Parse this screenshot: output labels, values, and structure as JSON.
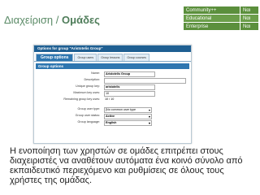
{
  "header": {
    "title_part1": "Διαχείριση",
    "separator": "/",
    "title_part2": "Ομάδες"
  },
  "editions": [
    {
      "name": "Community++",
      "value": "Ναι"
    },
    {
      "name": "Educational",
      "value": "Ναι"
    },
    {
      "name": "Enterprise",
      "value": "Ναι"
    }
  ],
  "screenshot": {
    "panel_title": "Options for group \"Aristotelis Group\"",
    "tabs": [
      "Group options",
      "Group users",
      "Group lessons",
      "Group courses"
    ],
    "section_title": "Group options",
    "fields": [
      {
        "label": "Name:",
        "value": "Aristotelis Group"
      },
      {
        "label": "Description:",
        "value": ""
      },
      {
        "label": "Unique group key:",
        "value": "aristotelis"
      },
      {
        "label": "Maximum key uses:",
        "value": "10"
      },
      {
        "label": "Remaining group key uses:",
        "value": "10 / 10"
      },
      {
        "label": "Group user type:",
        "value": "[No common user type"
      },
      {
        "label": "Group user status:",
        "value": "Active"
      },
      {
        "label": "Group language:",
        "value": "English"
      }
    ]
  },
  "footer": {
    "text": "Η ενοποίηση των χρηστών σε ομάδες επιτρέπει στους διαχειριστές να αναθέτουν αυτόματα ένα κοινό σύνολο από εκπαιδευτικό περιεχόμενο και ρυθμίσεις σε όλους τους χρήστες της ομάδας."
  }
}
